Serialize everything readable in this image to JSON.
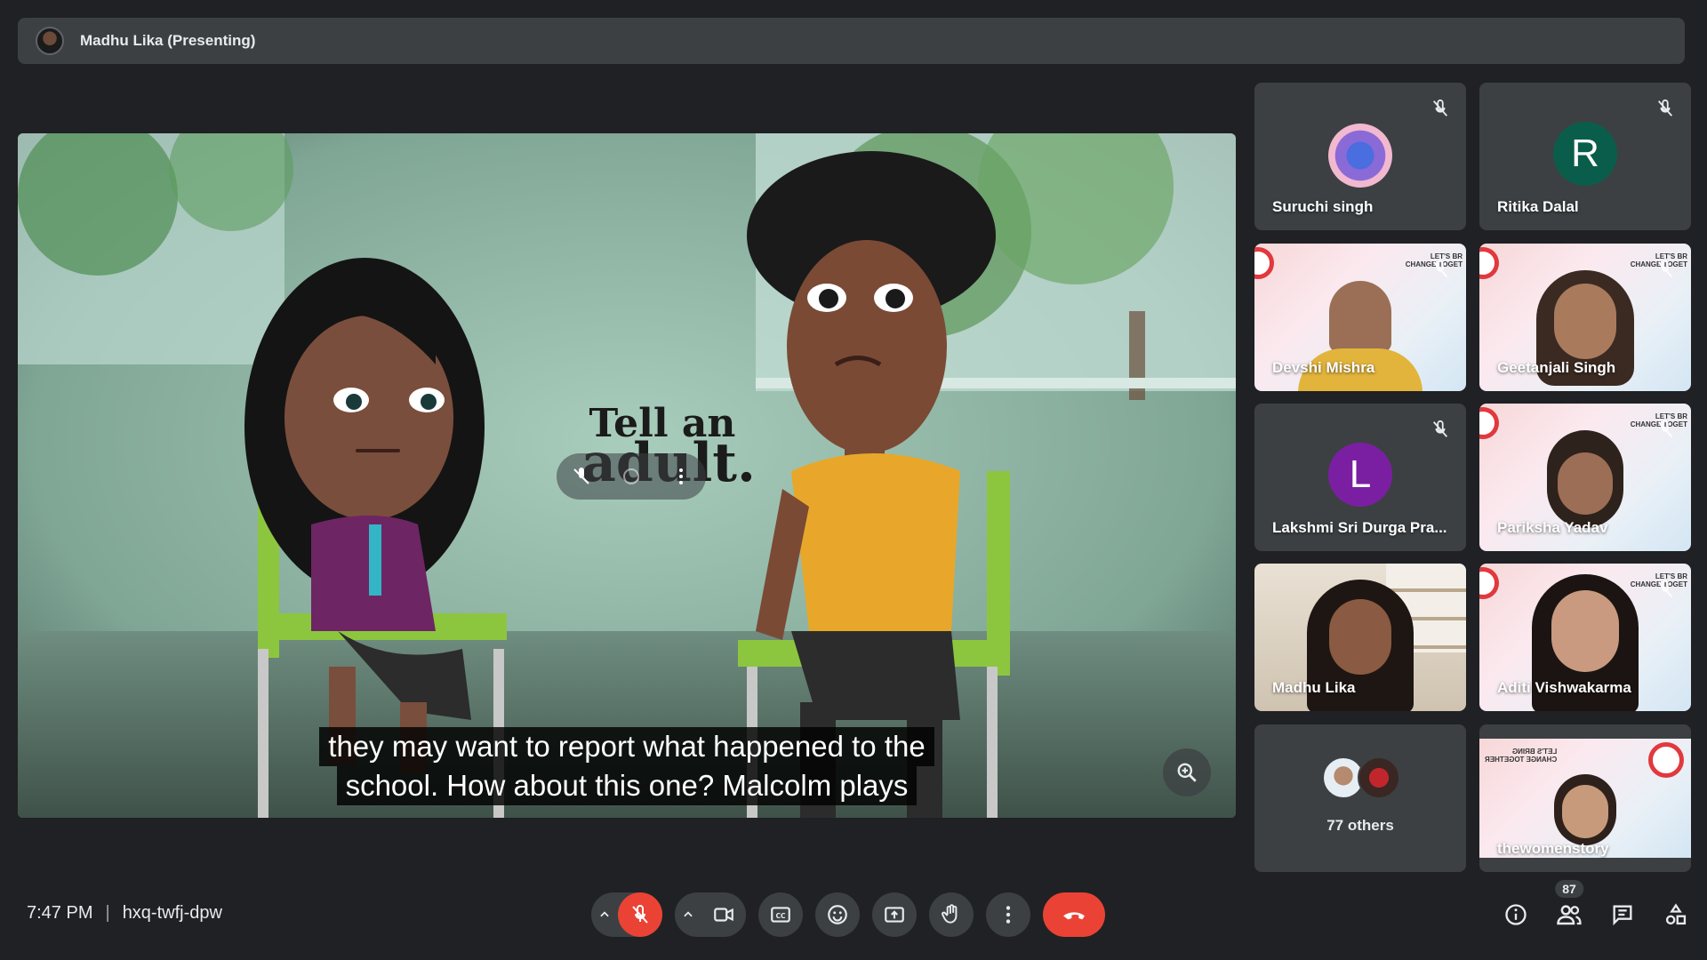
{
  "presenter": {
    "name": "Madhu Lika (Presenting)"
  },
  "presentation": {
    "overlay_text_line1": "Tell an",
    "overlay_text_line2": "adult.",
    "caption_line1": "they may want to report what happened to the",
    "caption_line2": "school. How about this one? Malcolm plays"
  },
  "participants": [
    {
      "name": "Suruchi singh",
      "type": "image-avatar",
      "muted": true
    },
    {
      "name": "Ritika Dalal",
      "type": "letter-avatar",
      "letter": "R",
      "color": "#0b5d4b",
      "muted": true
    },
    {
      "name": "Devshi Mishra",
      "type": "video",
      "muted": true
    },
    {
      "name": "Geetanjali Singh",
      "type": "video",
      "muted": true
    },
    {
      "name": "Lakshmi Sri Durga Pra...",
      "type": "letter-avatar",
      "letter": "L",
      "color": "#7b1fa2",
      "muted": true
    },
    {
      "name": "Pariksha Yadav",
      "type": "video",
      "muted": true
    },
    {
      "name": "Madhu Lika",
      "type": "video",
      "muted": false
    },
    {
      "name": "Aditi Vishwakarma",
      "type": "video",
      "muted": true
    },
    {
      "name": "77 others",
      "type": "others"
    },
    {
      "name": "thewomenstory",
      "type": "video",
      "muted": false
    }
  ],
  "tile_badge": {
    "line1": "LET'S BR",
    "line2": "CHANGE TOGET"
  },
  "tile_badge_mirror": {
    "line1": "LET'S BRING",
    "line2": "CHANGE TOGETHER"
  },
  "meeting": {
    "time": "7:47 PM",
    "separator": "|",
    "code": "hxq-twfj-dpw"
  },
  "people_count": "87",
  "colors": {
    "background": "#202124",
    "surface": "#3c4043",
    "danger": "#ea4335"
  }
}
